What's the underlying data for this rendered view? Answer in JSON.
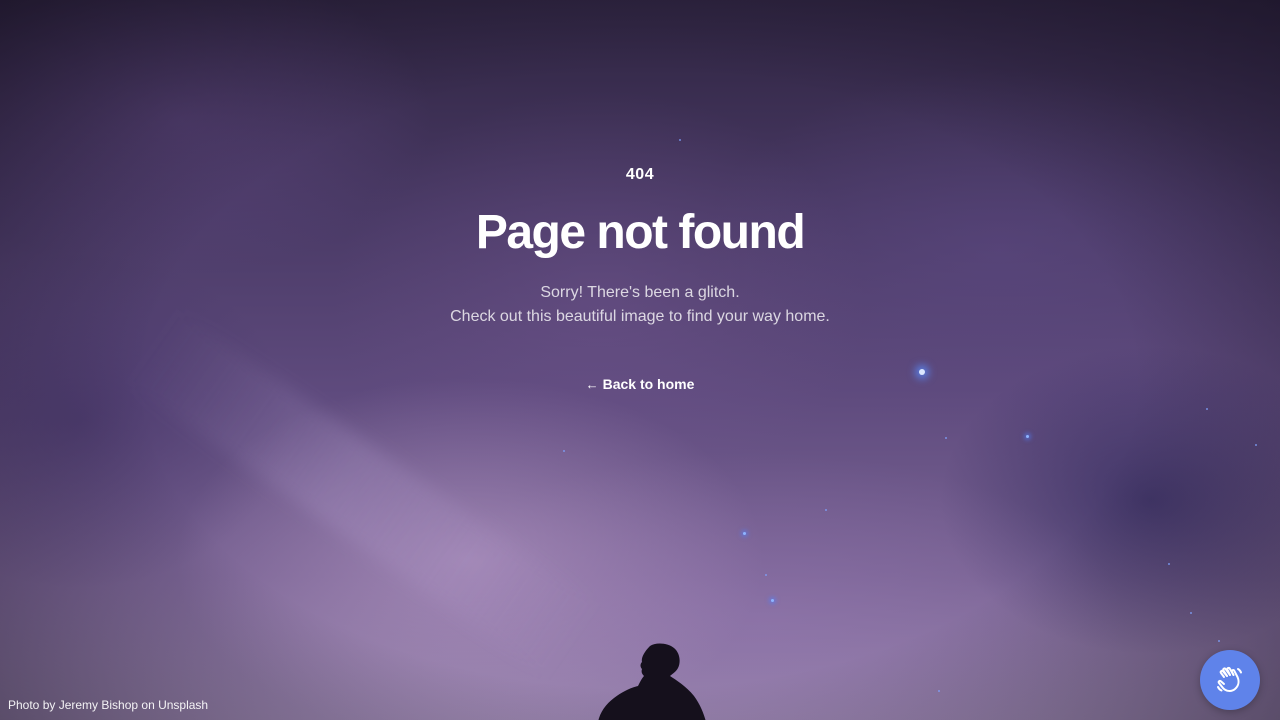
{
  "error": {
    "code": "404",
    "title": "Page not found",
    "message_line1": "Sorry! There's been a glitch.",
    "message_line2": "Check out this beautiful image to find your way home."
  },
  "actions": {
    "back_arrow_icon": "arrow-left-icon",
    "back_label": "Back to home"
  },
  "footer": {
    "photo_credit": "Photo by Jeremy Bishop on Unsplash"
  },
  "widget": {
    "icon": "waving-hand-icon",
    "color": "#5f83ea"
  },
  "colors": {
    "text": "#ffffff",
    "accent_star": "#8fb4ff"
  }
}
